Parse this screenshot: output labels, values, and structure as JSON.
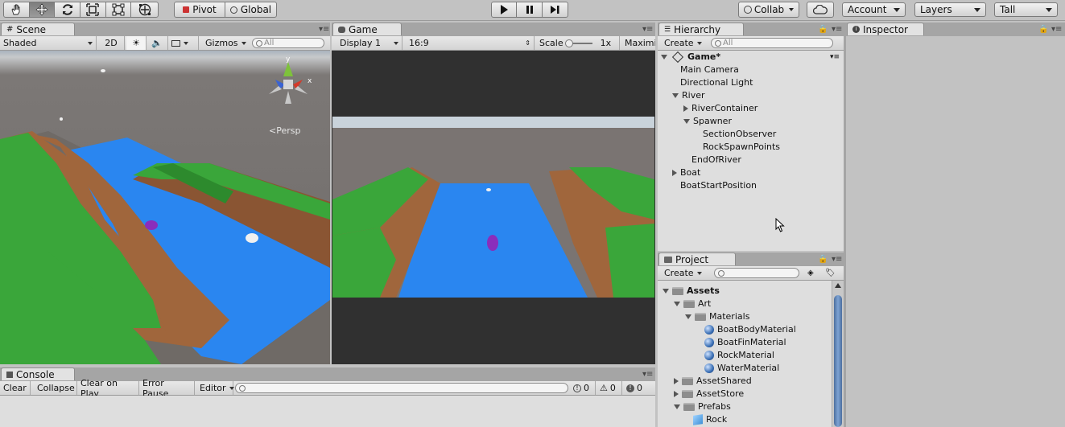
{
  "toolbar": {
    "tools": [
      "hand-tool-icon",
      "move-tool-icon",
      "rotate-tool-icon",
      "scale-tool-icon",
      "rect-tool-icon",
      "transform-tool-icon"
    ],
    "pivot": "Pivot",
    "global": "Global",
    "collab": "Collab",
    "account": "Account",
    "layers": "Layers",
    "layout": "Tall"
  },
  "scene": {
    "tab": "Scene",
    "shading": "Shaded",
    "mode2d": "2D",
    "gizmos": "Gizmos",
    "search_placeholder": "All",
    "persp": "Persp",
    "gizmo_axes": {
      "y": "y",
      "x": "x"
    }
  },
  "game": {
    "tab": "Game",
    "display": "Display 1",
    "aspect": "16:9",
    "scale_label": "Scale",
    "scale_value": "1x",
    "maximize": "Maximi"
  },
  "hierarchy": {
    "tab": "Hierarchy",
    "create": "Create",
    "search_placeholder": "All",
    "scene_name": "Game*",
    "items": [
      {
        "label": "Main Camera",
        "depth": 1,
        "arrow": ""
      },
      {
        "label": "Directional Light",
        "depth": 1,
        "arrow": ""
      },
      {
        "label": "River",
        "depth": 1,
        "arrow": "down"
      },
      {
        "label": "RiverContainer",
        "depth": 2,
        "arrow": "right"
      },
      {
        "label": "Spawner",
        "depth": 2,
        "arrow": "down"
      },
      {
        "label": "SectionObserver",
        "depth": 3,
        "arrow": ""
      },
      {
        "label": "RockSpawnPoints",
        "depth": 3,
        "arrow": ""
      },
      {
        "label": "EndOfRiver",
        "depth": 2,
        "arrow": ""
      },
      {
        "label": "Boat",
        "depth": 1,
        "arrow": "right"
      },
      {
        "label": "BoatStartPosition",
        "depth": 1,
        "arrow": ""
      }
    ]
  },
  "inspector": {
    "tab": "Inspector"
  },
  "project": {
    "tab": "Project",
    "create": "Create",
    "items": [
      {
        "label": "Assets",
        "depth": 0,
        "arrow": "down",
        "icon": "folder"
      },
      {
        "label": "Art",
        "depth": 1,
        "arrow": "down",
        "icon": "folder"
      },
      {
        "label": "Materials",
        "depth": 2,
        "arrow": "down",
        "icon": "folder"
      },
      {
        "label": "BoatBodyMaterial",
        "depth": 3,
        "arrow": "",
        "icon": "material"
      },
      {
        "label": "BoatFinMaterial",
        "depth": 3,
        "arrow": "",
        "icon": "material"
      },
      {
        "label": "RockMaterial",
        "depth": 3,
        "arrow": "",
        "icon": "material"
      },
      {
        "label": "WaterMaterial",
        "depth": 3,
        "arrow": "",
        "icon": "material"
      },
      {
        "label": "AssetShared",
        "depth": 1,
        "arrow": "right",
        "icon": "folder"
      },
      {
        "label": "AssetStore",
        "depth": 1,
        "arrow": "right",
        "icon": "folder"
      },
      {
        "label": "Prefabs",
        "depth": 1,
        "arrow": "down",
        "icon": "folder"
      },
      {
        "label": "Rock",
        "depth": 2,
        "arrow": "",
        "icon": "prefab"
      }
    ]
  },
  "console": {
    "tab": "Console",
    "clear": "Clear",
    "collapse": "Collapse",
    "clear_on_play": "Clear on Play",
    "error_pause": "Error Pause",
    "editor": "Editor",
    "info_count": "0",
    "warn_count": "0",
    "error_count": "0"
  },
  "colors": {
    "water": "#2a86f0",
    "grass": "#3aa63a",
    "dirt": "#a0663c"
  }
}
